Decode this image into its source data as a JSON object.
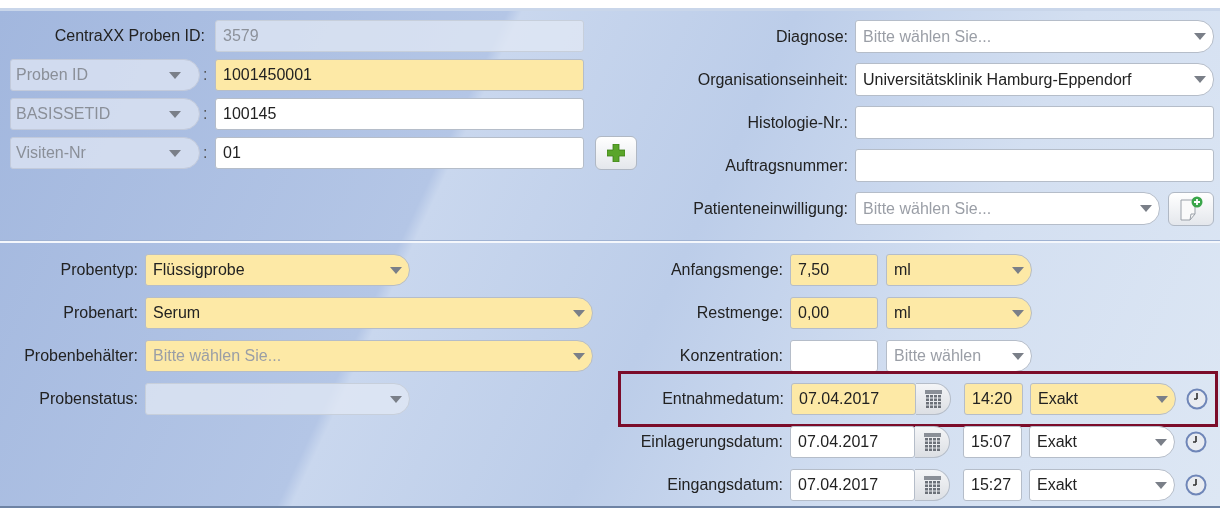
{
  "identifiers": [
    {
      "kind": "fixed",
      "label": "CentraXX Proben ID:",
      "value": "3579",
      "disabled": true
    },
    {
      "kind": "choice",
      "selector": "Proben ID",
      "colon": ":",
      "value": "1001450001",
      "required": true
    },
    {
      "kind": "choice",
      "selector": "BASISSETID",
      "colon": ":",
      "value": "100145",
      "required": false
    },
    {
      "kind": "choice",
      "selector": "Visiten-Nr",
      "colon": ":",
      "value": "01",
      "required": false,
      "add_button": true
    }
  ],
  "details": [
    {
      "kind": "select",
      "label": "Diagnose:",
      "placeholder": "Bitte wählen Sie..."
    },
    {
      "kind": "select",
      "label": "Organisationseinheit:",
      "value": "Universitätsklinik Hamburg-Eppendorf"
    },
    {
      "kind": "text",
      "label": "Histologie-Nr.:"
    },
    {
      "kind": "text",
      "label": "Auftragsnummer:"
    },
    {
      "kind": "select",
      "label": "Patienteneinwilligung:",
      "placeholder": "Bitte wählen Sie...",
      "add_button": true
    }
  ],
  "sample": [
    {
      "label": "Probentyp:",
      "value": "Flüssigprobe",
      "required": true
    },
    {
      "label": "Probenart:",
      "value": "Serum",
      "required": true
    },
    {
      "label": "Probenbehälter:",
      "placeholder": "Bitte wählen Sie...",
      "required": true
    },
    {
      "label": "Probenstatus:",
      "disabled": true
    }
  ],
  "quantities": [
    {
      "label": "Anfangsmenge:",
      "amount": "7,50",
      "unit": "ml",
      "required": true
    },
    {
      "label": "Restmenge:",
      "amount": "0,00",
      "unit": "ml",
      "required": true
    },
    {
      "label": "Konzentration:",
      "unit_placeholder": "Bitte wählen",
      "required": false
    }
  ],
  "dates": [
    {
      "label": "Entnahmedatum:",
      "date": "07.04.2017",
      "time": "14:20",
      "precision": "Exakt",
      "required": true,
      "highlighted": true
    },
    {
      "label": "Einlagerungsdatum:",
      "date": "07.04.2017",
      "time": "15:07",
      "precision": "Exakt",
      "required": false,
      "highlighted": false
    },
    {
      "label": "Eingangsdatum:",
      "date": "07.04.2017",
      "time": "15:27",
      "precision": "Exakt",
      "required": false,
      "highlighted": false
    }
  ]
}
